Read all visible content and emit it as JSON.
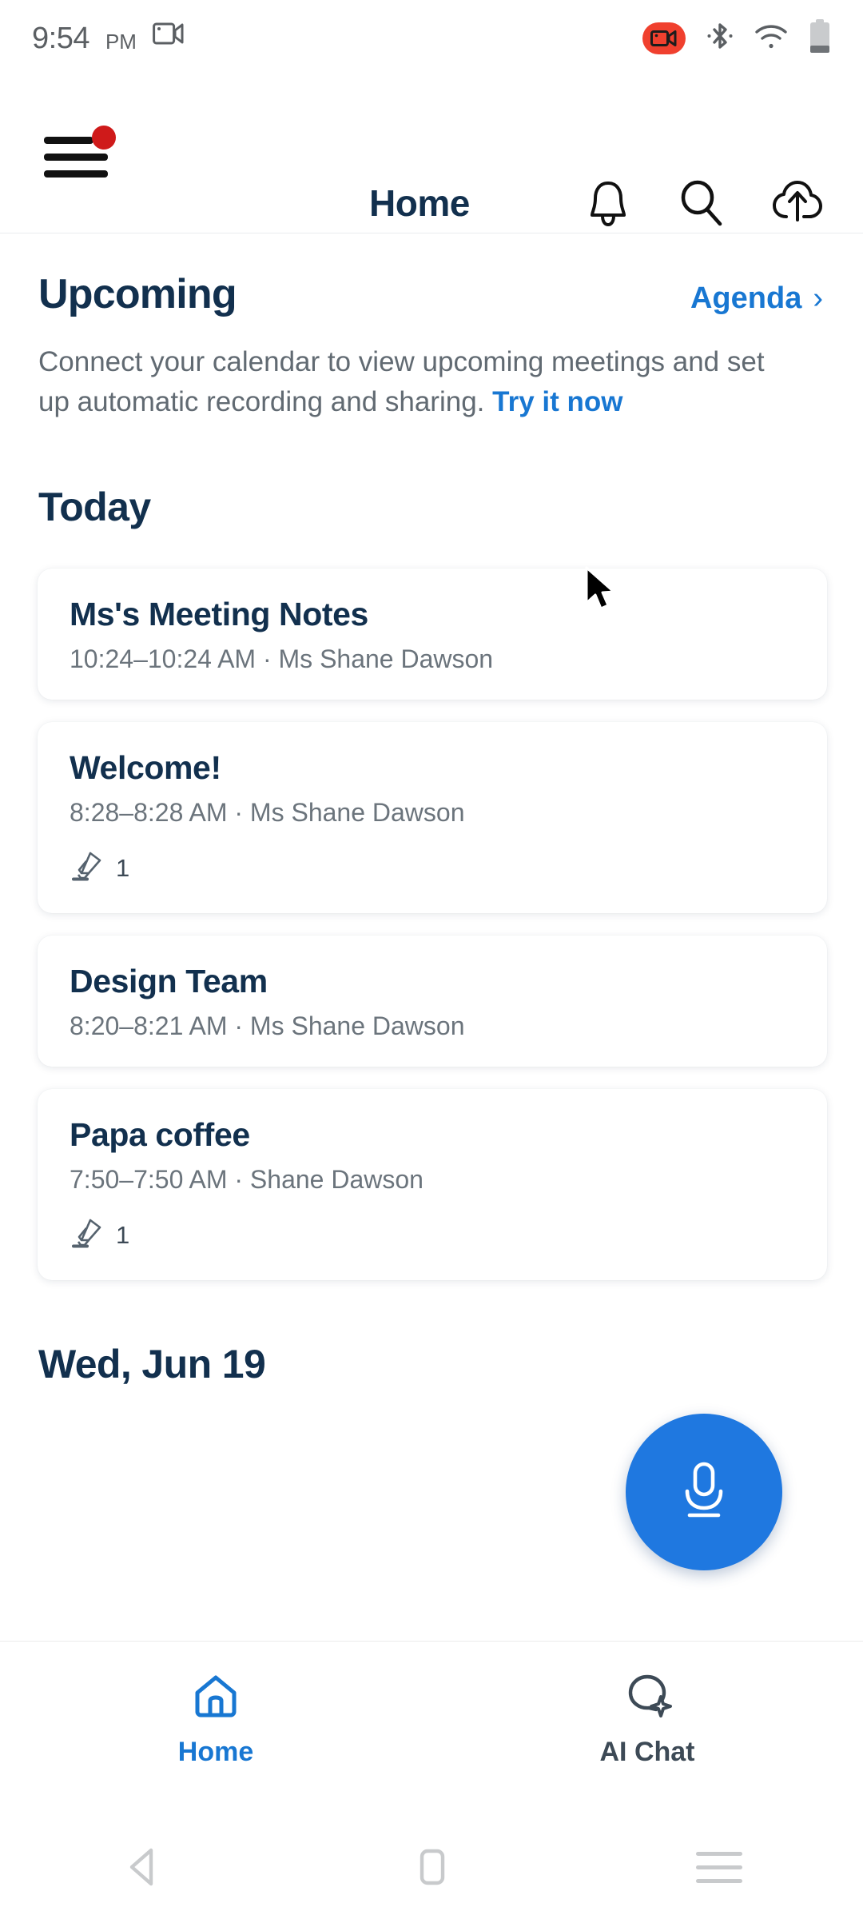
{
  "status_bar": {
    "time": "9:54",
    "ampm": "PM",
    "icons": [
      "video-camera-icon",
      "recording-badge-icon",
      "bluetooth-icon",
      "wifi-icon",
      "battery-icon"
    ],
    "recording_color": "#f0402e"
  },
  "app_bar": {
    "title": "Home",
    "menu_icon": "hamburger-menu-icon",
    "has_notification_dot": true,
    "notification_dot_color": "#cf1a1a",
    "icons": [
      "bell-icon",
      "search-icon",
      "cloud-upload-icon"
    ]
  },
  "upcoming": {
    "heading": "Upcoming",
    "agenda_label": "Agenda",
    "agenda_chevron": "›",
    "blurb_text": "Connect your calendar to view upcoming meetings and set up automatic recording and sharing. ",
    "blurb_link": "Try it now"
  },
  "today": {
    "heading": "Today",
    "cards": [
      {
        "title": "Ms's Meeting Notes",
        "meta": "10:24–10:24 AM ·  Ms Shane Dawson",
        "badge_count": null
      },
      {
        "title": "Welcome!",
        "meta": "8:28–8:28 AM ·  Ms Shane Dawson",
        "badge_count": "1"
      },
      {
        "title": "Design Team",
        "meta": "8:20–8:21 AM ·  Ms Shane Dawson",
        "badge_count": null
      },
      {
        "title": "Papa coffee",
        "meta": "7:50–7:50 AM ·  Shane Dawson",
        "badge_count": "1"
      }
    ]
  },
  "next_date": {
    "heading": "Wed, Jun 19"
  },
  "fab": {
    "icon": "microphone-icon",
    "color": "#1f78e0"
  },
  "bottom_nav": {
    "items": [
      {
        "label": "Home",
        "icon": "home-icon",
        "active": true
      },
      {
        "label": "AI Chat",
        "icon": "ai-chat-bubble-icon",
        "active": false
      }
    ],
    "active_color": "#1877d2",
    "idle_color": "#3d4a56"
  },
  "android_nav": {
    "back": "back-triangle-icon",
    "home": "home-square-icon",
    "recents": "recents-lines-icon"
  },
  "theme": {
    "heading_color": "#12304e",
    "body_color": "#616a72",
    "link_blue": "#1877d2"
  }
}
